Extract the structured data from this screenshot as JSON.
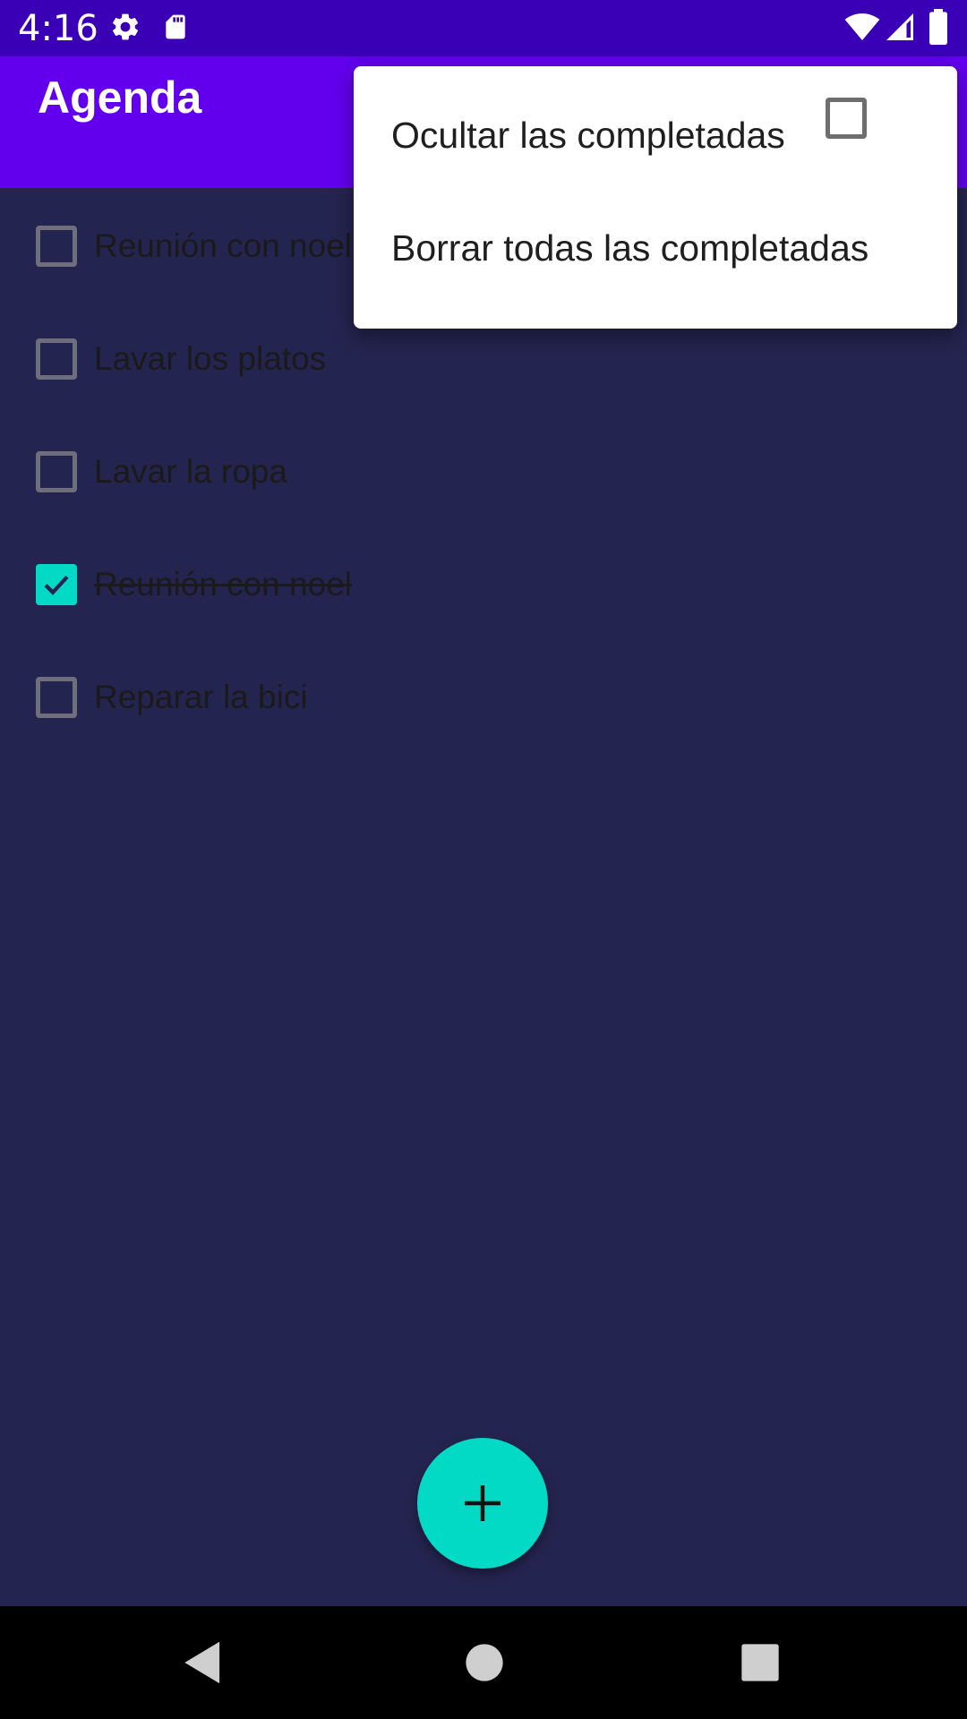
{
  "status_bar": {
    "time": "4:16",
    "icons": [
      "settings-icon",
      "sd-card-icon",
      "wifi-icon",
      "signal-icon",
      "battery-icon"
    ]
  },
  "app_bar": {
    "title": "Agenda"
  },
  "tasks": [
    {
      "label": "Reunión con noel",
      "completed": false
    },
    {
      "label": "Lavar los platos",
      "completed": false
    },
    {
      "label": "Lavar la ropa",
      "completed": false
    },
    {
      "label": "Reunión con noel",
      "completed": true
    },
    {
      "label": "Reparar la bici",
      "completed": false
    }
  ],
  "menu": {
    "hide_completed_label": "Ocultar las completadas",
    "hide_completed_checked": false,
    "delete_completed_label": "Borrar todas las completadas"
  },
  "fab": {
    "icon": "plus-icon"
  },
  "nav_bar": {
    "icons": [
      "back-icon",
      "home-icon",
      "recents-icon"
    ]
  },
  "colors": {
    "status_bar": "#3a00b5",
    "app_bar": "#6200ee",
    "background": "#242450",
    "accent": "#03dac5"
  }
}
